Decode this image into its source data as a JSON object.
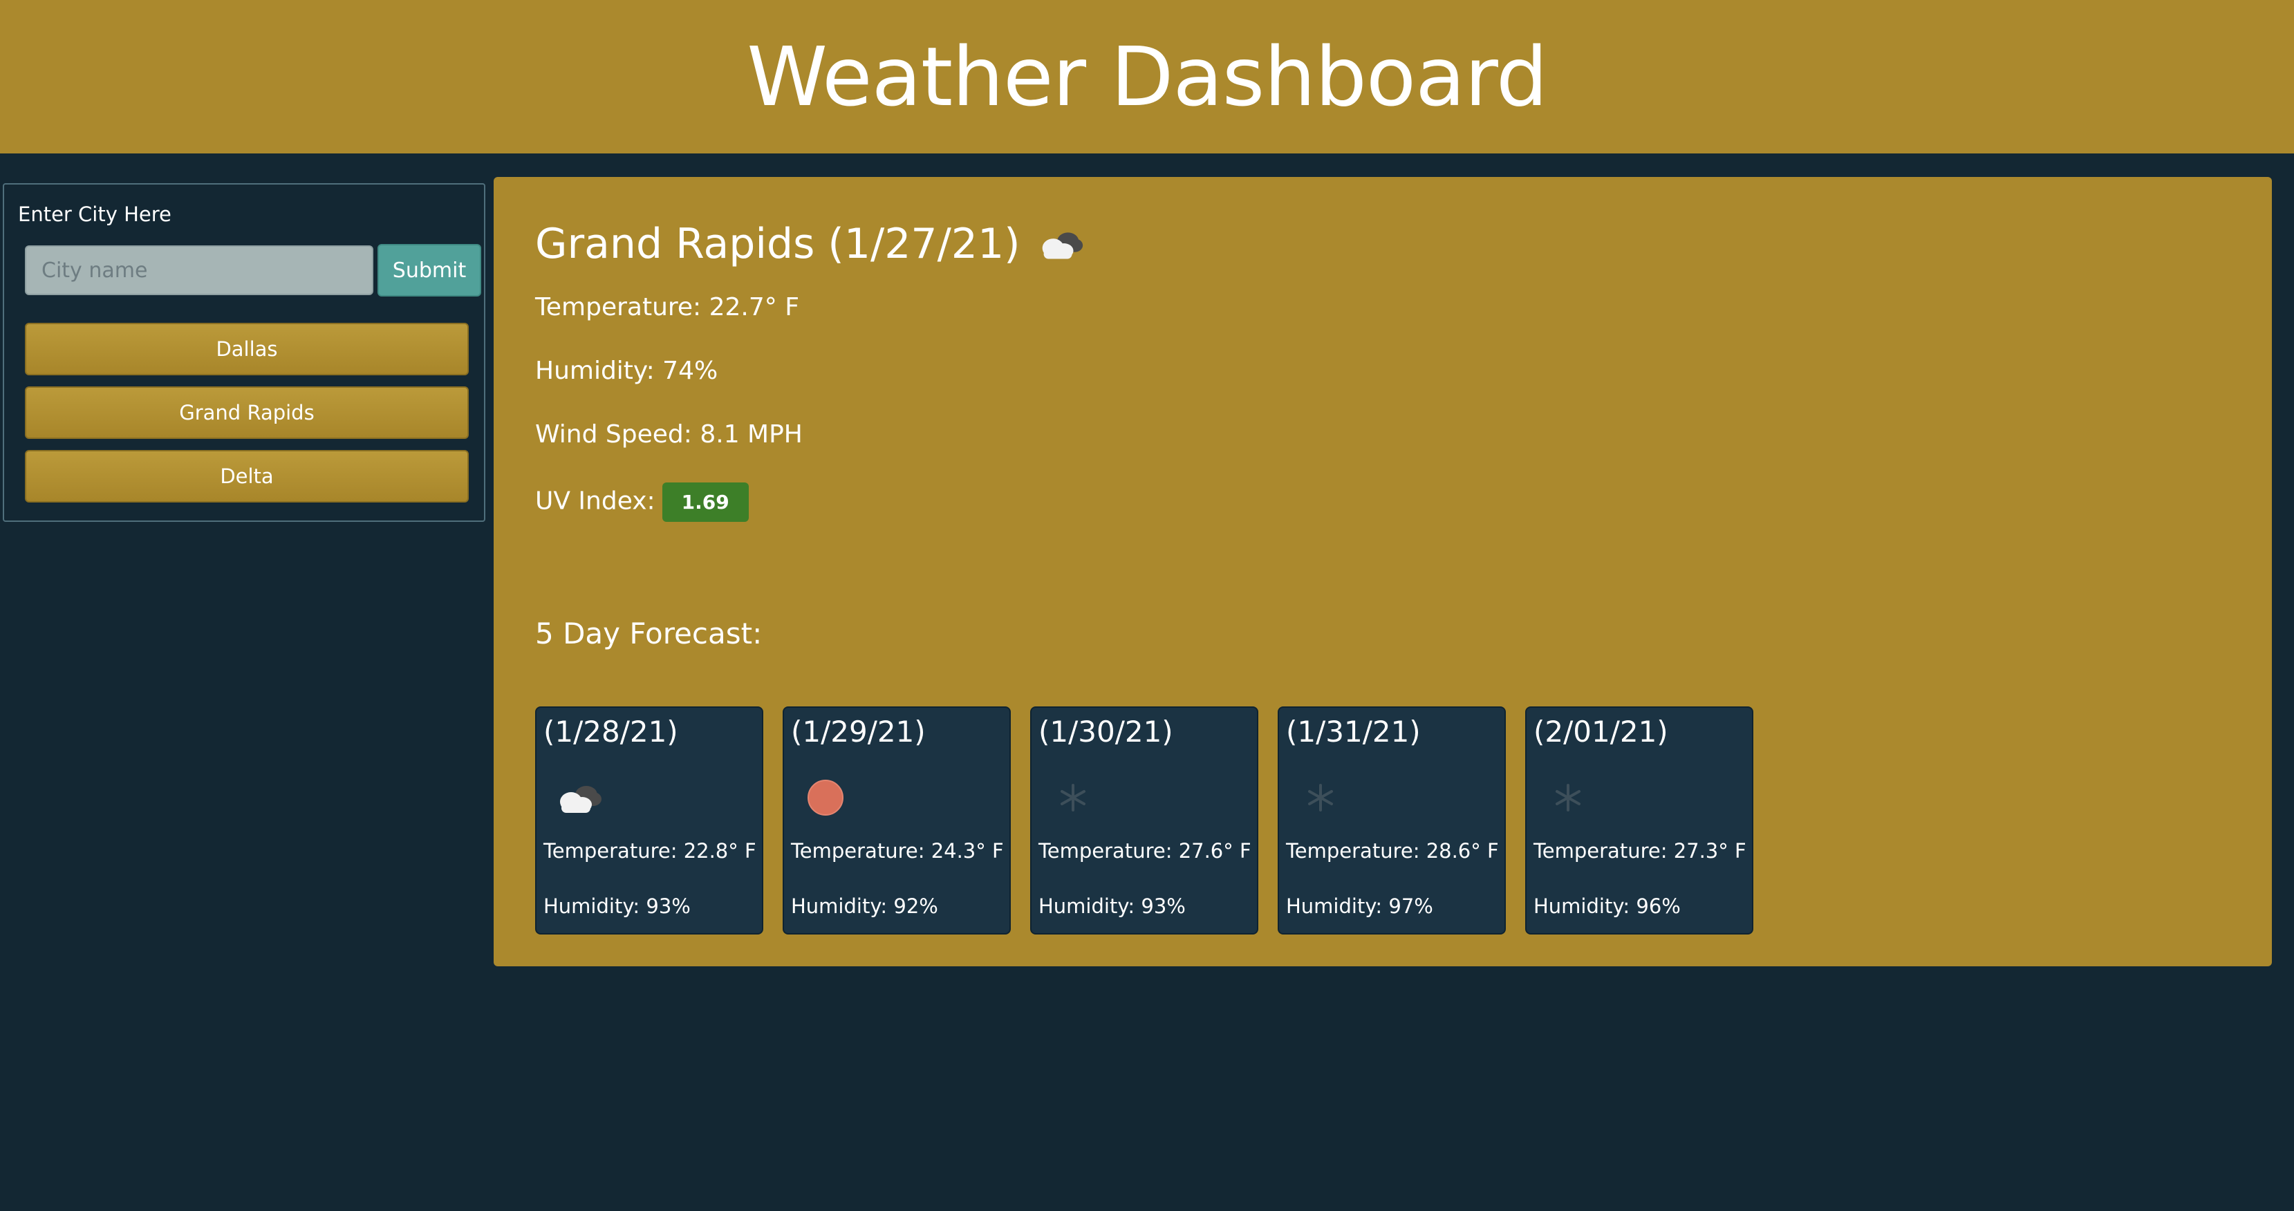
{
  "header": {
    "title": "Weather Dashboard"
  },
  "search": {
    "label": "Enter City Here",
    "placeholder": "City name",
    "value": "",
    "submit_label": "Submit",
    "history": [
      "Dallas",
      "Grand Rapids",
      "Delta"
    ]
  },
  "current": {
    "title": "Grand Rapids (1/27/21)",
    "icon": "cloudy-icon",
    "temperature": "Temperature: 22.7° F",
    "humidity": "Humidity: 74%",
    "wind": "Wind Speed: 8.1 MPH",
    "uv_label": "UV Index:",
    "uv_value": "1.69",
    "uv_color": "#3d7f28"
  },
  "forecast": {
    "title": "5 Day Forecast:",
    "days": [
      {
        "date": "(1/28/21)",
        "icon": "cloudy-icon",
        "temperature": "Temperature: 22.8° F",
        "humidity": "Humidity: 93%"
      },
      {
        "date": "(1/29/21)",
        "icon": "sun-icon",
        "temperature": "Temperature: 24.3° F",
        "humidity": "Humidity: 92%"
      },
      {
        "date": "(1/30/21)",
        "icon": "snow-icon",
        "temperature": "Temperature: 27.6° F",
        "humidity": "Humidity: 93%"
      },
      {
        "date": "(1/31/21)",
        "icon": "snow-icon",
        "temperature": "Temperature: 28.6° F",
        "humidity": "Humidity: 97%"
      },
      {
        "date": "(2/01/21)",
        "icon": "snow-icon",
        "temperature": "Temperature: 27.3° F",
        "humidity": "Humidity: 96%"
      }
    ]
  },
  "colors": {
    "accent": "#ab892d",
    "background": "#132733",
    "card": "#1b3343",
    "submit": "#51a19a"
  }
}
